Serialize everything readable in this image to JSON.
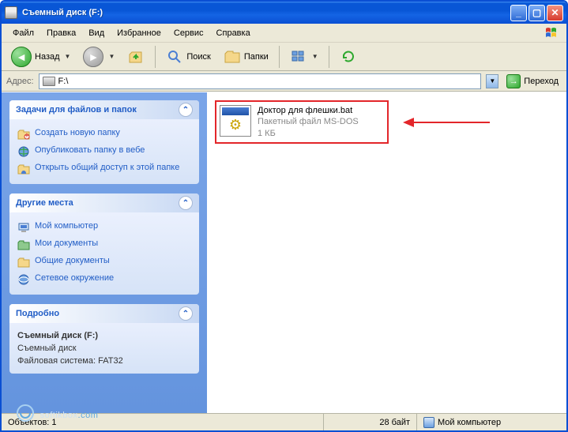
{
  "window": {
    "title": "Съемный диск (F:)"
  },
  "menu": {
    "file": "Файл",
    "edit": "Правка",
    "view": "Вид",
    "favorites": "Избранное",
    "tools": "Сервис",
    "help": "Справка"
  },
  "toolbar": {
    "back": "Назад",
    "search": "Поиск",
    "folders": "Папки"
  },
  "addressbar": {
    "label": "Адрес:",
    "value": "F:\\",
    "go": "Переход"
  },
  "sidebar": {
    "tasks": {
      "title": "Задачи для файлов и папок",
      "items": [
        "Создать новую папку",
        "Опубликовать папку в вебе",
        "Открыть общий доступ к этой папке"
      ]
    },
    "places": {
      "title": "Другие места",
      "items": [
        "Мой компьютер",
        "Мои документы",
        "Общие документы",
        "Сетевое окружение"
      ]
    },
    "details": {
      "title": "Подробно",
      "name": "Съемный диск (F:)",
      "type": "Съемный диск",
      "fs_label": "Файловая система:",
      "fs_value": "FAT32"
    }
  },
  "file": {
    "name": "Доктор для флешки.bat",
    "type": "Пакетный файл MS-DOS",
    "size": "1 КБ"
  },
  "statusbar": {
    "objects": "Объектов: 1",
    "bytes": "28 байт",
    "location": "Мой компьютер"
  },
  "watermark": {
    "part1": "softikbox",
    "part2": ".com"
  }
}
